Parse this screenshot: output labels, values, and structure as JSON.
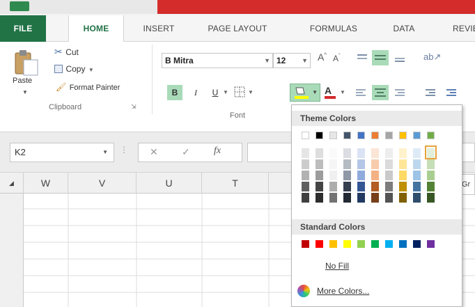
{
  "tabs": [
    "FILE",
    "HOME",
    "INSERT",
    "PAGE LAYOUT",
    "FORMULAS",
    "DATA",
    "REVIEW"
  ],
  "clipboard": {
    "paste": "Paste",
    "cut": "Cut",
    "copy": "Copy",
    "format_painter": "Format Painter",
    "group_label": "Clipboard"
  },
  "font": {
    "name": "B Mitra",
    "size": "12",
    "group_label": "Font",
    "bold": "B",
    "italic": "I",
    "underline": "U"
  },
  "name_box": "K2",
  "columns": [
    "W",
    "V",
    "U",
    "T"
  ],
  "color_menu": {
    "theme_label": "Theme Colors",
    "standard_label": "Standard Colors",
    "no_fill": "No Fill",
    "more_colors": "More Colors...",
    "theme_colors": [
      "#ffffff",
      "#000000",
      "#e7e6e6",
      "#44546a",
      "#4472c4",
      "#ed7d31",
      "#a5a5a5",
      "#ffc000",
      "#5b9bd5",
      "#70ad47"
    ],
    "standard_colors": [
      "#c00000",
      "#ff0000",
      "#ffc000",
      "#ffff00",
      "#92d050",
      "#00b050",
      "#00b0f0",
      "#0070c0",
      "#002060",
      "#7030a0"
    ]
  },
  "partial_label": "Gr",
  "colors": {
    "excel_green": "#217346",
    "selected_tint": "#a9dbb9",
    "red_banner": "#d42b2b"
  }
}
